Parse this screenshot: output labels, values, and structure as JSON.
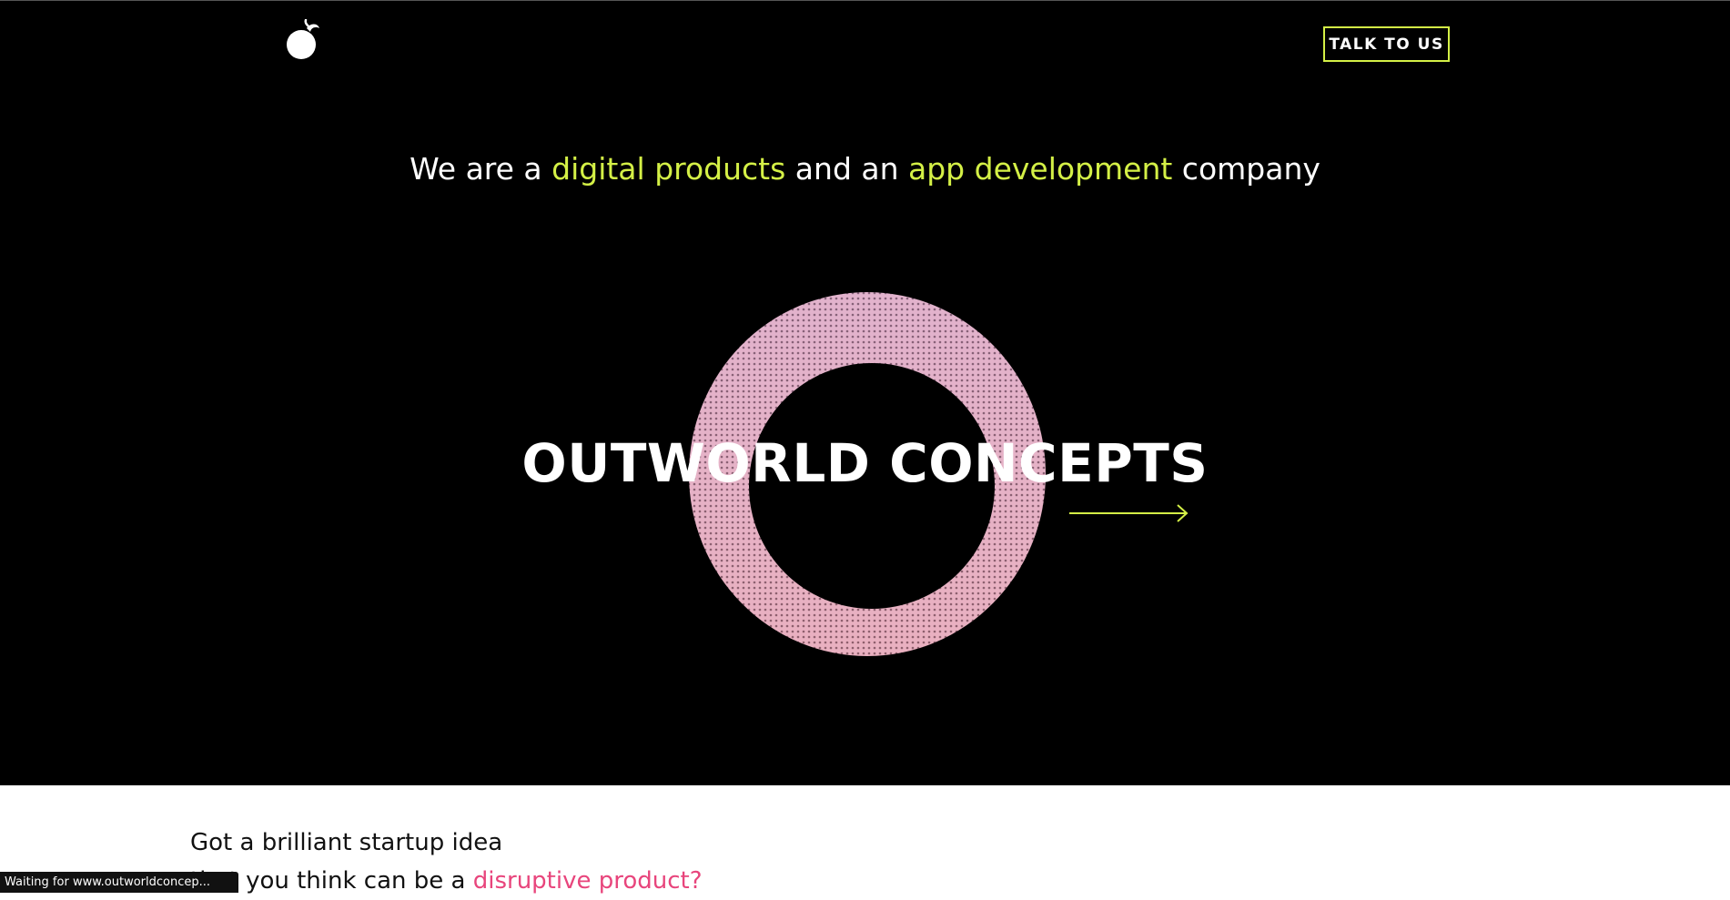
{
  "header": {
    "logo_icon": "planet-moon-icon",
    "cta_label": "TALK TO US"
  },
  "hero": {
    "tagline": {
      "part1": "We are a ",
      "highlight1": "digital products",
      "part2": " and an ",
      "highlight2": "app development",
      "part3": " company"
    },
    "title": "OUTWORLD CONCEPTS",
    "graphic": "dotted-ring-graphic",
    "arrow_icon": "arrow-right-icon"
  },
  "intro": {
    "line1": "Got a brilliant startup idea",
    "line2_prefix": "that you think can be a ",
    "line2_highlight": "disruptive product?"
  },
  "status_bar": {
    "text": "Waiting for www.outworldconcep..."
  },
  "colors": {
    "background": "#000000",
    "accent_lime": "#d4f046",
    "accent_pink": "#e8457c",
    "text": "#ffffff"
  }
}
